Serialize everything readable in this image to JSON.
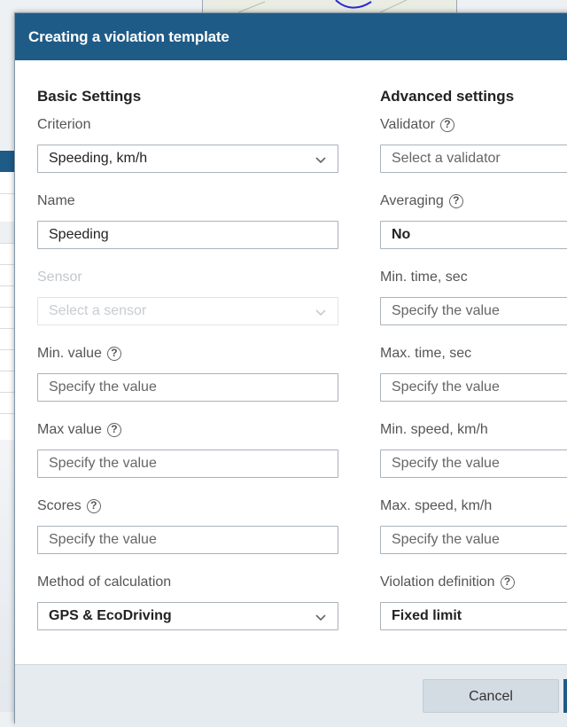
{
  "dialog": {
    "title": "Creating a violation template",
    "cancel_label": "Cancel"
  },
  "basic": {
    "title": "Basic Settings",
    "criterion": {
      "label": "Criterion",
      "value": "Speeding, km/h"
    },
    "name": {
      "label": "Name",
      "value": "Speeding"
    },
    "sensor": {
      "label": "Sensor",
      "placeholder": "Select a sensor"
    },
    "min_value": {
      "label": "Min. value",
      "placeholder": "Specify the value"
    },
    "max_value": {
      "label": "Max value",
      "placeholder": "Specify the value"
    },
    "scores": {
      "label": "Scores",
      "placeholder": "Specify the value"
    },
    "method": {
      "label": "Method of calculation",
      "value": "GPS & EcoDriving"
    }
  },
  "advanced": {
    "title": "Advanced settings",
    "validator": {
      "label": "Validator",
      "placeholder": "Select a validator"
    },
    "averaging": {
      "label": "Averaging",
      "value": "No"
    },
    "min_time": {
      "label": "Min. time, sec",
      "placeholder": "Specify the value"
    },
    "max_time": {
      "label": "Max. time, sec",
      "placeholder": "Specify the value"
    },
    "min_speed": {
      "label": "Min. speed, km/h",
      "placeholder": "Specify the value"
    },
    "max_speed": {
      "label": "Max. speed, km/h",
      "placeholder": "Specify the value"
    },
    "violation_definition": {
      "label": "Violation definition",
      "value": "Fixed limit"
    }
  },
  "icons": {
    "help": "?"
  },
  "colors": {
    "header": "#1f5b87",
    "footer": "#e6ebf0"
  }
}
